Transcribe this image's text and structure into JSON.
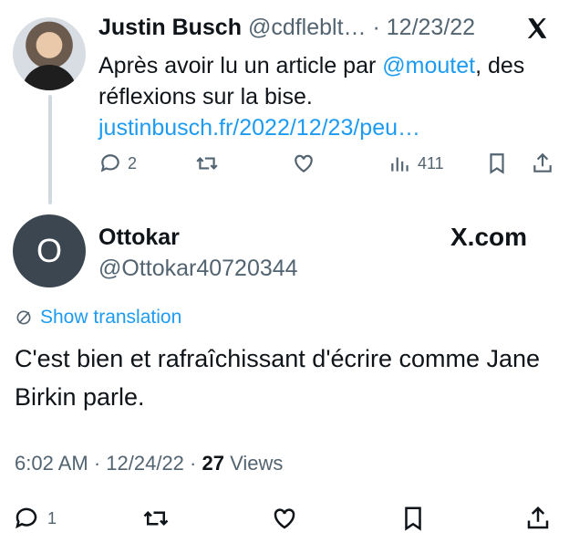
{
  "tweet1": {
    "display_name": "Justin Busch",
    "handle": "@cdfleblt…",
    "date": "· 12/23/22",
    "text_before": "Après avoir lu un article par ",
    "mention": "@moutet",
    "text_after": ", des réflexions sur la bise. ",
    "link": "justinbusch.fr/2022/12/23/peu…",
    "replies": "2",
    "views": "411"
  },
  "tweet2": {
    "display_name": "Ottokar",
    "handle": "@Ottokar40720344",
    "avatar_letter": "O",
    "brand": "X.com",
    "show_translation": "Show translation",
    "text": "C'est bien et rafraîchissant d'écrire comme Jane Birkin parle.",
    "time": "6:02 AM",
    "date": "· 12/24/22 ·",
    "views_count": "27",
    "views_label": "Views",
    "replies": "1"
  },
  "colors": {
    "link": "#1d9bf0",
    "muted": "#536471",
    "text": "#0f1419",
    "avatar2_bg": "#3b4651"
  },
  "icons": [
    "reply-icon",
    "retweet-icon",
    "like-icon",
    "views-icon",
    "bookmark-icon",
    "share-icon",
    "x-logo-icon",
    "translate-icon"
  ]
}
